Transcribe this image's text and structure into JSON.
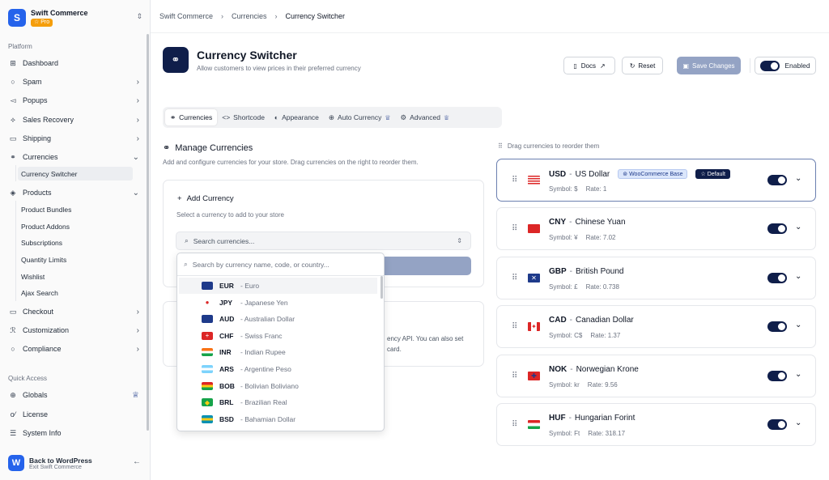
{
  "brand": {
    "name": "Swift Commerce",
    "badge": "☆ Pro",
    "logo_icon": "S"
  },
  "sidebar": {
    "platform_label": "Platform",
    "items": [
      {
        "label": "Dashboard",
        "icon": "⊞"
      },
      {
        "label": "Spam",
        "icon": "○"
      },
      {
        "label": "Popups",
        "icon": "◅"
      },
      {
        "label": "Sales Recovery",
        "icon": "⟡"
      },
      {
        "label": "Shipping",
        "icon": "▭"
      },
      {
        "label": "Currencies",
        "icon": "⚭"
      },
      {
        "label": "Products",
        "icon": "◈"
      },
      {
        "label": "Checkout",
        "icon": "▭"
      },
      {
        "label": "Customization",
        "icon": "ℛ"
      },
      {
        "label": "Compliance",
        "icon": "○"
      }
    ],
    "currencies_sub": [
      "Currency Switcher"
    ],
    "products_sub": [
      "Product Bundles",
      "Product Addons",
      "Subscriptions",
      "Quantity Limits",
      "Wishlist",
      "Ajax Search"
    ],
    "quick_access_label": "Quick Access",
    "quick": [
      {
        "label": "Globals",
        "icon": "⊕"
      },
      {
        "label": "License",
        "icon": "o⁄"
      },
      {
        "label": "System Info",
        "icon": "☰"
      }
    ],
    "back": {
      "title": "Back to WordPress",
      "subtitle": "Exit Swift Commerce"
    }
  },
  "breadcrumb": [
    "Swift Commerce",
    "Currencies",
    "Currency Switcher"
  ],
  "header": {
    "title": "Currency Switcher",
    "subtitle": "Allow customers to view prices in their preferred currency",
    "docs": "Docs",
    "reset": "Reset",
    "save": "Save Changes",
    "enabled": "Enabled"
  },
  "tabs": [
    {
      "label": "Currencies",
      "icon": "⚭"
    },
    {
      "label": "Shortcode",
      "icon": "<>"
    },
    {
      "label": "Appearance",
      "icon": "◐"
    },
    {
      "label": "Auto Currency",
      "icon": "⊕"
    },
    {
      "label": "Advanced",
      "icon": "⚙"
    }
  ],
  "manage": {
    "title": "Manage Currencies",
    "subtitle": "Add and configure currencies for your store. Drag currencies on the right to reorder them.",
    "add_title": "Add Currency",
    "add_sub": "Select a currency to add to your store",
    "search_placeholder": "Search currencies...",
    "card2_line1": "ency API. You can also set",
    "card2_line2": "card."
  },
  "dropdown": {
    "placeholder": "Search by currency name, code, or country...",
    "items": [
      {
        "code": "EUR",
        "name": "- Euro",
        "flag": "eu"
      },
      {
        "code": "JPY",
        "name": "- Japanese Yen",
        "flag": "jp"
      },
      {
        "code": "AUD",
        "name": "- Australian Dollar",
        "flag": "au"
      },
      {
        "code": "CHF",
        "name": "- Swiss Franc",
        "flag": "ch"
      },
      {
        "code": "INR",
        "name": "- Indian Rupee",
        "flag": "in"
      },
      {
        "code": "ARS",
        "name": "- Argentine Peso",
        "flag": "ar"
      },
      {
        "code": "BOB",
        "name": "- Bolivian Boliviano",
        "flag": "bo"
      },
      {
        "code": "BRL",
        "name": "- Brazilian Real",
        "flag": "br"
      },
      {
        "code": "BSD",
        "name": "- Bahamian Dollar",
        "flag": "bs"
      }
    ]
  },
  "drag_hint": "Drag currencies to reorder them",
  "currencies": [
    {
      "code": "USD",
      "name": "US Dollar",
      "symbol": "Symbol: $",
      "rate": "Rate: 1",
      "flag": "us",
      "wc": "WooCommerce Base",
      "def": "☆ Default"
    },
    {
      "code": "CNY",
      "name": "Chinese Yuan",
      "symbol": "Symbol: ¥",
      "rate": "Rate: 7.02",
      "flag": "cn"
    },
    {
      "code": "GBP",
      "name": "British Pound",
      "symbol": "Symbol: £",
      "rate": "Rate: 0.738",
      "flag": "gb"
    },
    {
      "code": "CAD",
      "name": "Canadian Dollar",
      "symbol": "Symbol: C$",
      "rate": "Rate: 1.37",
      "flag": "ca"
    },
    {
      "code": "NOK",
      "name": "Norwegian Krone",
      "symbol": "Symbol: kr",
      "rate": "Rate: 9.56",
      "flag": "no"
    },
    {
      "code": "HUF",
      "name": "Hungarian Forint",
      "symbol": "Symbol: Ft",
      "rate": "Rate: 318.17",
      "flag": "hu"
    }
  ]
}
